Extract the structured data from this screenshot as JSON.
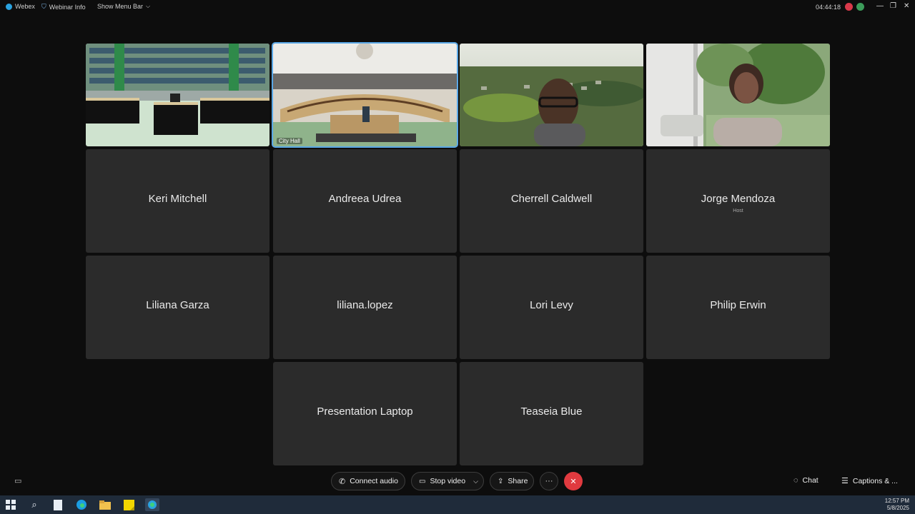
{
  "topbar": {
    "app_name": "Webex",
    "webinar_info": "Webinar Info",
    "menu_bar": "Show Menu Bar",
    "timer": "04:44:18"
  },
  "videos": [
    {
      "label": ""
    },
    {
      "label": "City Hall"
    },
    {
      "label": ""
    },
    {
      "label": ""
    }
  ],
  "participants": [
    {
      "name": "Keri Mitchell",
      "role": ""
    },
    {
      "name": "Andreea Udrea",
      "role": ""
    },
    {
      "name": "Cherrell Caldwell",
      "role": ""
    },
    {
      "name": "Jorge Mendoza",
      "role": "Host"
    },
    {
      "name": "Liliana Garza",
      "role": ""
    },
    {
      "name": "liliana.lopez",
      "role": ""
    },
    {
      "name": "Lori Levy",
      "role": ""
    },
    {
      "name": "Philip Erwin",
      "role": ""
    },
    {
      "name": "Presentation Laptop",
      "role": ""
    },
    {
      "name": "Teaseia Blue",
      "role": ""
    }
  ],
  "controls": {
    "connect_audio": "Connect audio",
    "stop_video": "Stop video",
    "share": "Share",
    "more": "···",
    "leave": "✕",
    "chat": "Chat",
    "captions": "Captions & ..."
  },
  "taskbar": {
    "time": "12:57 PM",
    "date": "5/8/2025"
  },
  "colors": {
    "tile_bg": "#2b2b2b",
    "active_border": "#5aa7e6",
    "leave_red": "#e03a3f",
    "taskbar": "#1f2b3a"
  }
}
